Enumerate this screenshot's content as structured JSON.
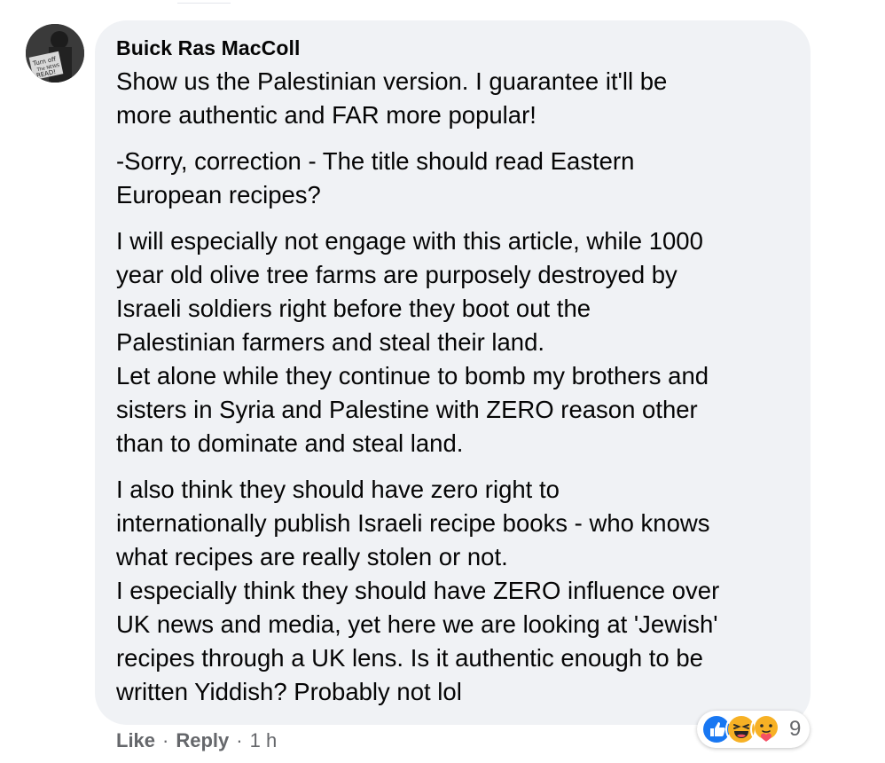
{
  "comment": {
    "author": "Buick Ras MacColl",
    "avatar_text": [
      "Turn off",
      "The NEWS",
      "READ!"
    ],
    "paragraphs": [
      [
        "Show us the Palestinian version. I guarantee it'll be",
        "more authentic and FAR more popular!"
      ],
      [
        "-Sorry, correction - The title should read Eastern",
        "European recipes?"
      ],
      [
        "I will especially not engage with this article, while 1000",
        "year old olive tree farms are purposely destroyed by",
        "Israeli soldiers right before they boot out the",
        "Palestinian farmers and steal their land.",
        "Let alone while they continue to bomb my brothers and",
        "sisters in Syria and Palestine with ZERO reason other",
        "than to dominate and steal land."
      ],
      [
        "I also think they should have zero right to",
        "internationally publish Israeli recipe books - who knows",
        "what recipes are really stolen or not.",
        "I especially think they should have ZERO influence over",
        "UK news and media, yet here we are looking at 'Jewish'",
        "recipes through a UK lens. Is it authentic enough to be",
        "written Yiddish? Probably not lol"
      ]
    ]
  },
  "actions": {
    "like": "Like",
    "separator": "·",
    "reply": "Reply",
    "time": "1 h"
  },
  "reactions": {
    "icons": [
      "like-icon",
      "haha-icon",
      "care-icon"
    ],
    "count": "9",
    "colors": {
      "like": "#1877f2",
      "haha": "#f7b125",
      "care": "#f7b125"
    }
  }
}
